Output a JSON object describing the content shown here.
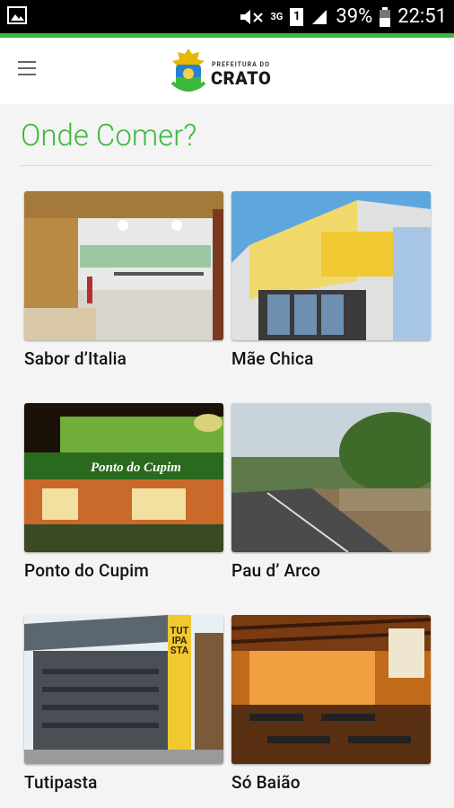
{
  "status_bar": {
    "signal_label": "3G",
    "sim_label": "1",
    "battery": "39%",
    "time": "22:51",
    "icons": [
      "image-icon",
      "mute-icon",
      "network-3g-icon",
      "sim-icon",
      "signal-icon",
      "battery-icon"
    ]
  },
  "header": {
    "logo_small": "PREFEITURA DO",
    "logo_big": "CRATO"
  },
  "page_title": "Onde Comer?",
  "restaurants": [
    {
      "name": "Sabor d’Italia"
    },
    {
      "name": "Mãe Chica"
    },
    {
      "name": "Ponto do Cupim"
    },
    {
      "name": "Pau d’ Arco"
    },
    {
      "name": "Tutipasta"
    },
    {
      "name": "Só Baião"
    }
  ],
  "photo_signs": {
    "ponto": "Ponto do Cupim",
    "tutipasta_sign": "TUTIPASTA"
  },
  "colors": {
    "accent": "#3cb93c",
    "text": "#111111",
    "background": "#f4f4f4"
  }
}
